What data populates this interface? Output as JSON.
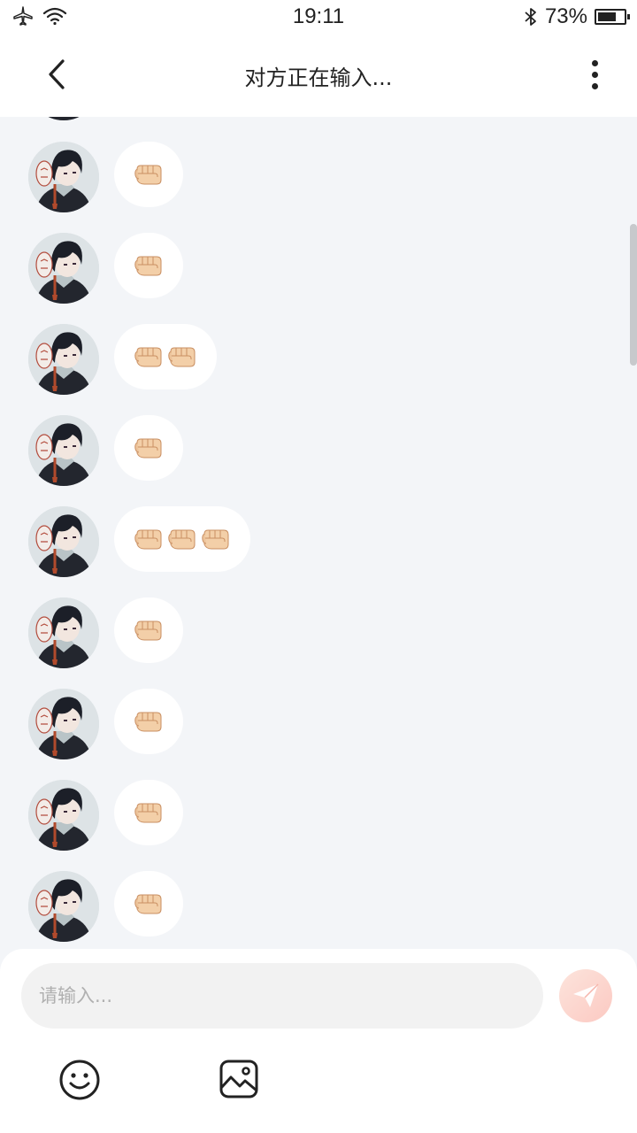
{
  "status_bar": {
    "time": "19:11",
    "battery_text": "73%",
    "battery_level": 0.73,
    "icons": [
      "airplane-icon",
      "wifi-icon",
      "bluetooth-icon",
      "battery-icon"
    ]
  },
  "header": {
    "title": "对方正在输入...",
    "back_icon": "chevron-left-icon",
    "more_icon": "more-vertical-icon"
  },
  "messages": [
    {
      "sender": "other",
      "content": "👊",
      "count": 1
    },
    {
      "sender": "other",
      "content": "👊",
      "count": 1
    },
    {
      "sender": "other",
      "content": "👊👊",
      "count": 2
    },
    {
      "sender": "other",
      "content": "👊",
      "count": 1
    },
    {
      "sender": "other",
      "content": "👊👊👊",
      "count": 3
    },
    {
      "sender": "other",
      "content": "👊",
      "count": 1
    },
    {
      "sender": "other",
      "content": "👊",
      "count": 1
    },
    {
      "sender": "other",
      "content": "👊",
      "count": 1
    },
    {
      "sender": "other",
      "content": "👊",
      "count": 1
    }
  ],
  "composer": {
    "placeholder": "请输入...",
    "value": "",
    "send_icon": "send-icon",
    "emoji_icon": "smiley-icon",
    "image_icon": "image-icon"
  },
  "colors": {
    "background": "#f3f5f8",
    "bubble": "#ffffff",
    "send_button": "#fbc9c2"
  }
}
